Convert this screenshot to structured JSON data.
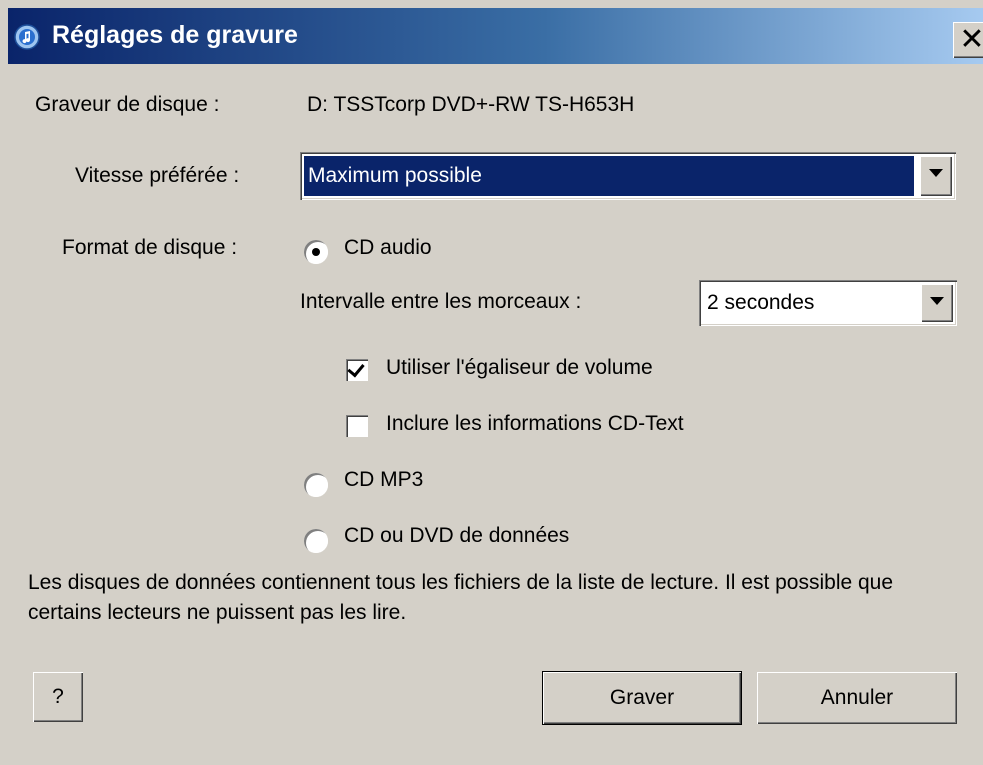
{
  "window": {
    "title": "Réglages de gravure",
    "close_glyph": "✕",
    "icon": "itunes-icon"
  },
  "burner": {
    "label": "Graveur de disque :",
    "value": "D: TSSTcorp DVD+-RW TS-H653H"
  },
  "speed": {
    "label": "Vitesse préférée :",
    "selected": "Maximum possible"
  },
  "format": {
    "label": "Format de disque :",
    "options": [
      {
        "label": "CD audio",
        "checked": true
      },
      {
        "label": "CD MP3",
        "checked": false
      },
      {
        "label": "CD ou DVD de données",
        "checked": false
      }
    ],
    "gap_label": "Intervalle entre les morceaux :",
    "gap_selected": "2 secondes",
    "checkboxes": [
      {
        "label": "Utiliser l'égaliseur de volume",
        "checked": true
      },
      {
        "label": "Inclure les informations CD-Text",
        "checked": false
      }
    ]
  },
  "note": "Les disques de données contiennent tous les fichiers de la liste de lecture. Il est possible que certains lecteurs ne puissent pas les lire.",
  "buttons": {
    "help": "?",
    "burn": "Graver",
    "cancel": "Annuler"
  }
}
